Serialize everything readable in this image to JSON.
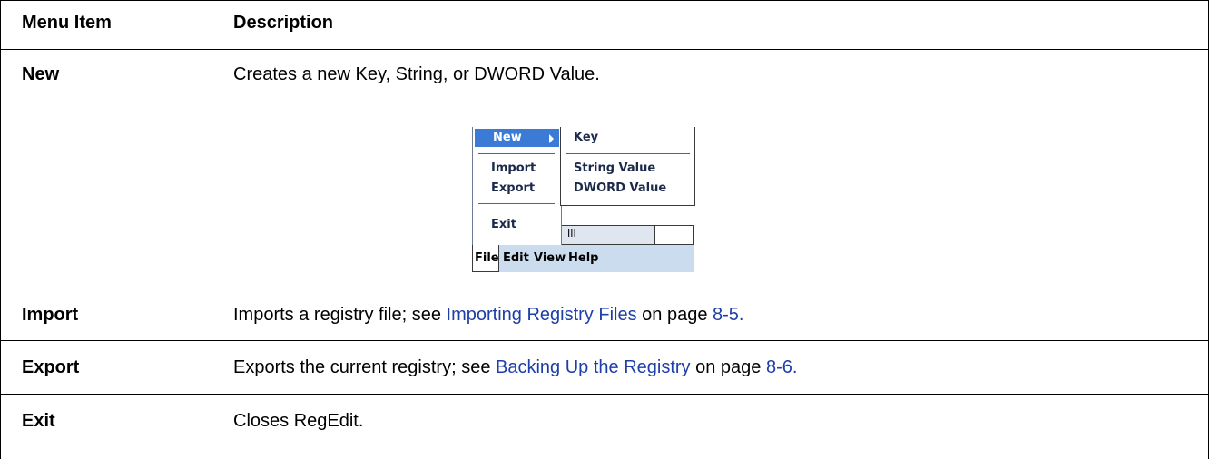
{
  "table": {
    "headers": [
      "Menu Item",
      "Description"
    ],
    "rows": [
      {
        "item": "New",
        "description": "Creates a new Key, String, or DWORD Value."
      },
      {
        "item": "Import",
        "description_before": "Imports a registry file; see ",
        "link": "Importing Registry Files",
        "middle": " on page ",
        "page": "8-5."
      },
      {
        "item": "Export",
        "description_before": "Exports the current registry; see ",
        "link": "Backing Up the Registry",
        "middle": " on page ",
        "page": "8-6."
      },
      {
        "item": "Exit",
        "description": "Closes RegEdit."
      }
    ]
  },
  "screenshot": {
    "file_menu": {
      "new": "New",
      "import": "Import",
      "export": "Export",
      "exit": "Exit"
    },
    "submenu": {
      "key": "Key",
      "string_value": "String Value",
      "dword_value": "DWORD Value"
    },
    "menubar": [
      "File",
      "Edit",
      "View",
      "Help"
    ],
    "column_glyph": "III",
    "colors": {
      "selection": "#3b7bd6",
      "menubar": "#cbdcee",
      "link": "#1e3fa8"
    }
  }
}
